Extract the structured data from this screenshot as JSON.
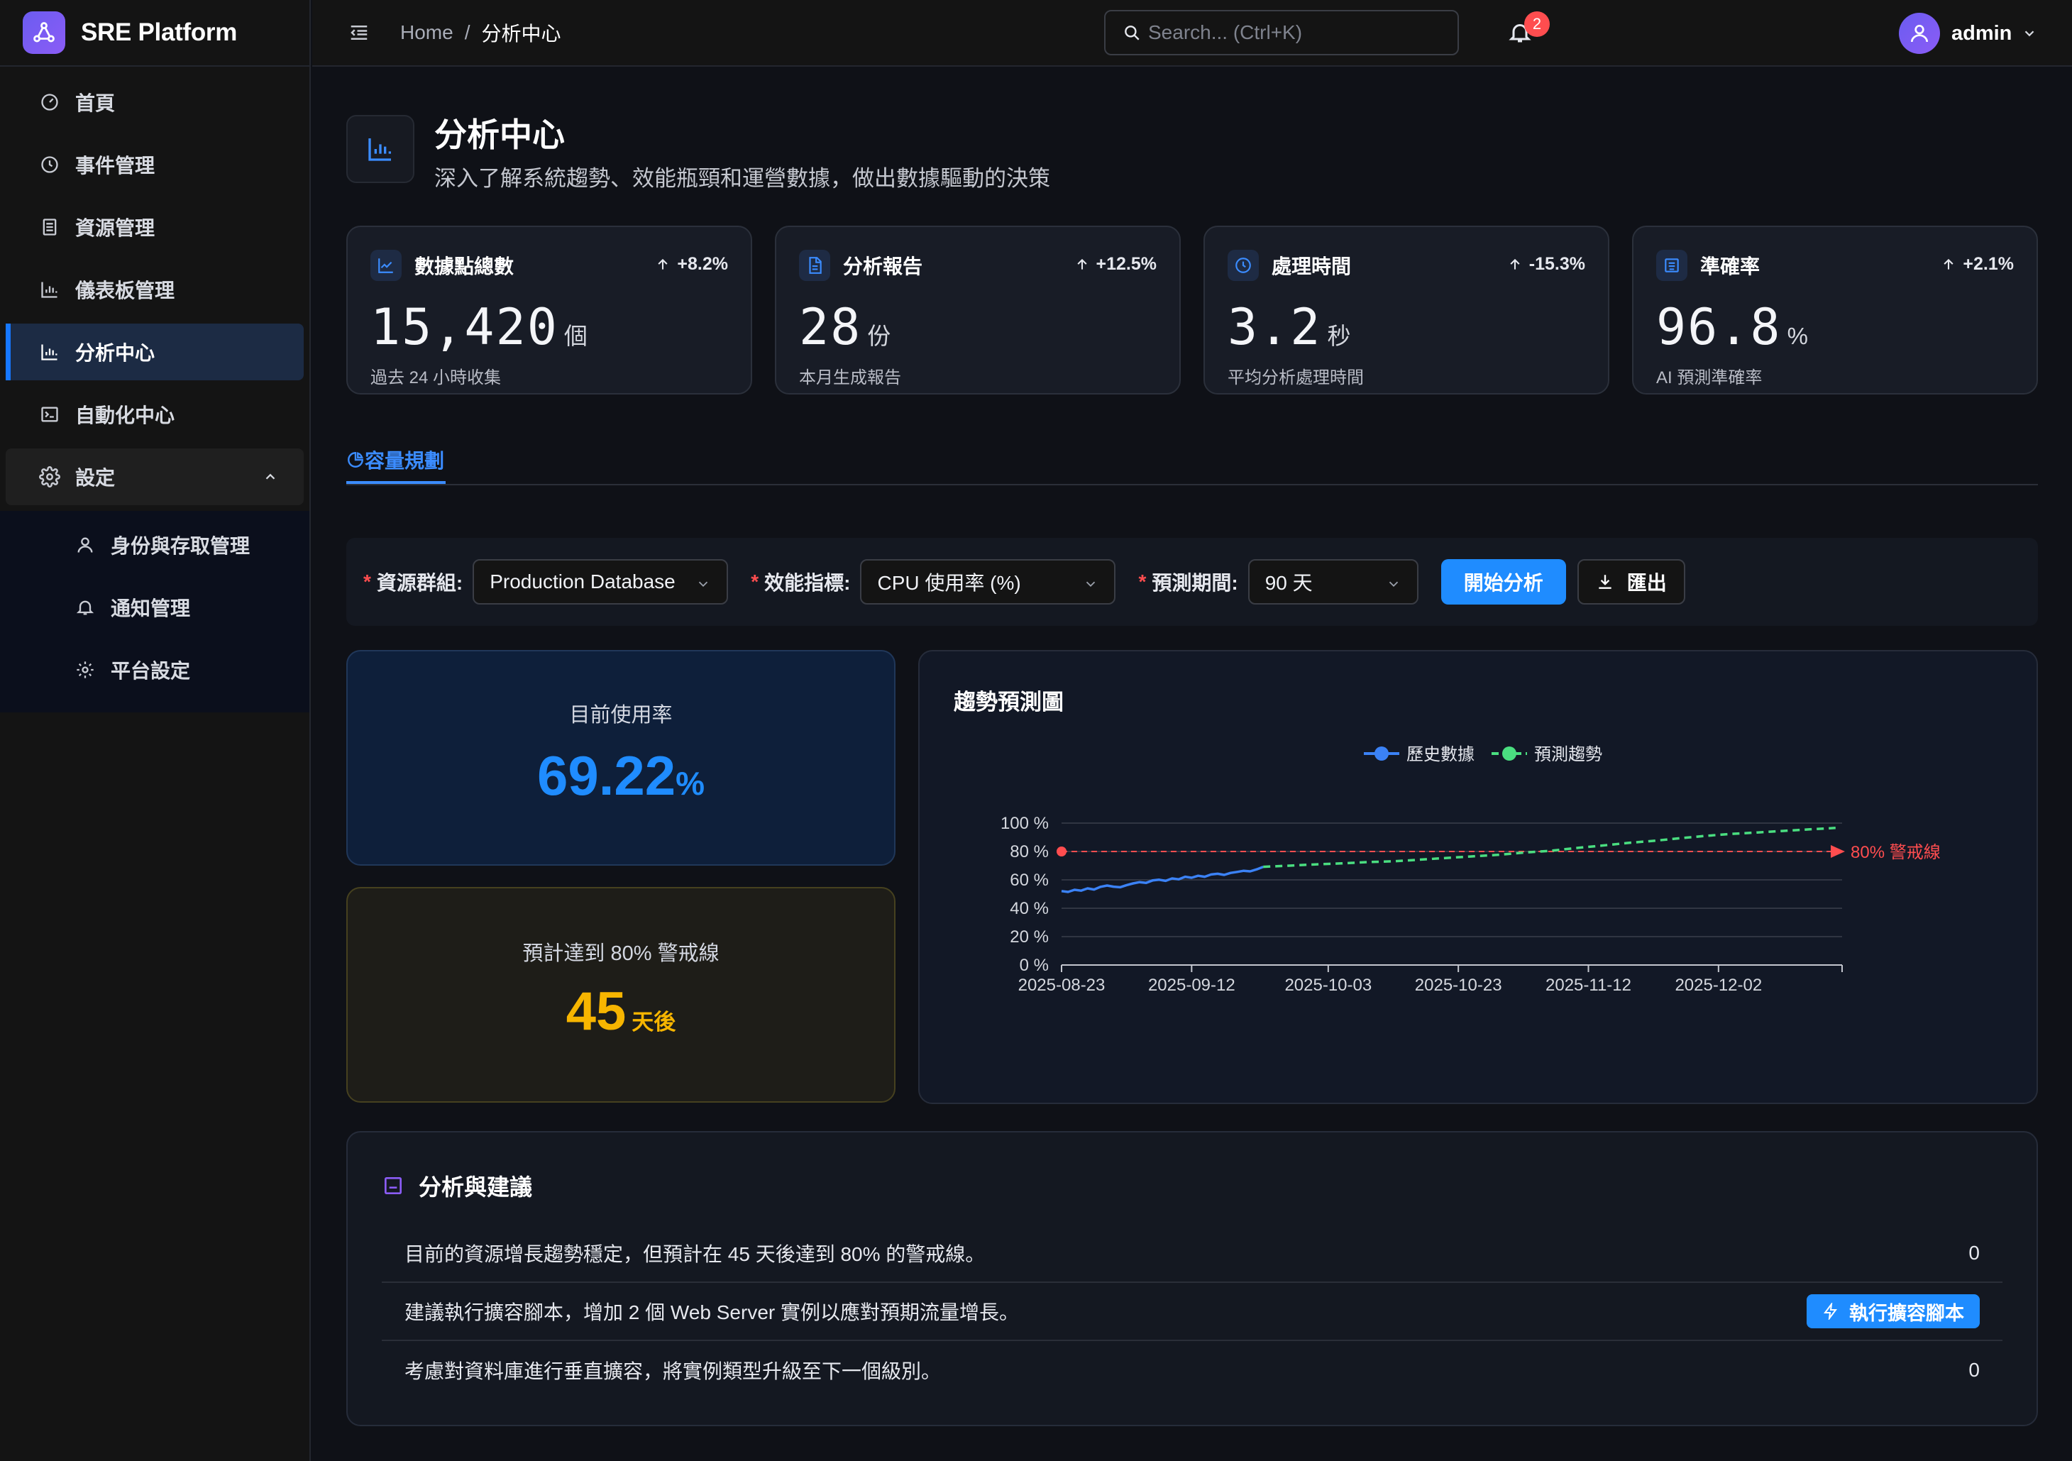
{
  "app": {
    "name": "SRE Platform"
  },
  "sidebar": {
    "items": [
      {
        "label": "首頁",
        "icon": "dashboard-gauge-icon"
      },
      {
        "label": "事件管理",
        "icon": "clock-icon"
      },
      {
        "label": "資源管理",
        "icon": "server-icon"
      },
      {
        "label": "儀表板管理",
        "icon": "bar-chart-icon"
      },
      {
        "label": "分析中心",
        "icon": "bar-chart-icon",
        "active": true
      },
      {
        "label": "自動化中心",
        "icon": "terminal-icon"
      },
      {
        "label": "設定",
        "icon": "gear-icon",
        "expanded": true
      }
    ],
    "submenu": [
      {
        "label": "身份與存取管理",
        "icon": "user-icon"
      },
      {
        "label": "通知管理",
        "icon": "bell-icon"
      },
      {
        "label": "平台設定",
        "icon": "gear-icon"
      }
    ]
  },
  "header": {
    "breadcrumb": {
      "home": "Home",
      "separator": "/",
      "current": "分析中心"
    },
    "search": {
      "placeholder": "Search... (Ctrl+K)"
    },
    "notifications": {
      "count": "2"
    },
    "user": {
      "name": "admin"
    }
  },
  "page": {
    "title": "分析中心",
    "subtitle": "深入了解系統趨勢、效能瓶頸和運營數據，做出數據驅動的決策"
  },
  "stats": [
    {
      "label": "數據點總數",
      "trend": "+8.2%",
      "value": "15,420",
      "unit": "個",
      "desc": "過去 24 小時收集",
      "icon": "line-chart-icon"
    },
    {
      "label": "分析報告",
      "trend": "+12.5%",
      "value": "28",
      "unit": "份",
      "desc": "本月生成報告",
      "icon": "file-text-icon"
    },
    {
      "label": "處理時間",
      "trend": "-15.3%",
      "value": "3.2",
      "unit": "秒",
      "desc": "平均分析處理時間",
      "icon": "clock-icon"
    },
    {
      "label": "準確率",
      "trend": "+2.1%",
      "value": "96.8",
      "unit": "%",
      "desc": "AI 預測準確率",
      "icon": "robot-icon"
    }
  ],
  "tabs": [
    {
      "label": "容量規劃",
      "icon": "pie-chart-icon",
      "active": true
    }
  ],
  "filters": {
    "resource_group": {
      "label": "資源群組:",
      "value": "Production Database"
    },
    "metric": {
      "label": "效能指標:",
      "value": "CPU 使用率 (%)"
    },
    "period": {
      "label": "預測期間:",
      "value": "90 天"
    },
    "required_mark": "*",
    "start_button": "開始分析",
    "export_button": "匯出"
  },
  "usage": {
    "label": "目前使用率",
    "value": "69.22",
    "unit": "%"
  },
  "eta": {
    "label": "預計達到 80% 警戒線",
    "value": "45",
    "unit": "天後"
  },
  "chart_title": "趨勢預測圖",
  "chart_data": {
    "type": "line",
    "title": "趨勢預測圖",
    "xlabel": "",
    "ylabel": "",
    "y_ticks": [
      "0 %",
      "20 %",
      "40 %",
      "60 %",
      "80 %",
      "100 %"
    ],
    "ylim": [
      0,
      100
    ],
    "x_ticks": [
      "2025-08-23",
      "2025-09-12",
      "2025-10-03",
      "2025-10-23",
      "2025-11-12",
      "2025-12-02"
    ],
    "legend_position": "top-center",
    "threshold": {
      "value": 80,
      "label": "80% 警戒線",
      "color": "#ff4d4f"
    },
    "series": [
      {
        "name": "歷史數據",
        "color": "#3b82f6",
        "style": "solid",
        "points": [
          [
            "2025-08-23",
            52.1
          ],
          [
            "2025-08-24",
            51.5
          ],
          [
            "2025-08-25",
            53.0
          ],
          [
            "2025-08-26",
            52.4
          ],
          [
            "2025-08-27",
            54.0
          ],
          [
            "2025-08-28",
            53.2
          ],
          [
            "2025-08-29",
            55.1
          ],
          [
            "2025-08-30",
            56.0
          ],
          [
            "2025-08-31",
            55.2
          ],
          [
            "2025-09-01",
            54.8
          ],
          [
            "2025-09-02",
            56.3
          ],
          [
            "2025-09-03",
            57.5
          ],
          [
            "2025-09-04",
            58.4
          ],
          [
            "2025-09-05",
            57.9
          ],
          [
            "2025-09-06",
            59.6
          ],
          [
            "2025-09-07",
            60.1
          ],
          [
            "2025-09-08",
            59.3
          ],
          [
            "2025-09-09",
            61.0
          ],
          [
            "2025-09-10",
            60.4
          ],
          [
            "2025-09-11",
            62.2
          ],
          [
            "2025-09-12",
            61.5
          ],
          [
            "2025-09-13",
            62.9
          ],
          [
            "2025-09-14",
            62.2
          ],
          [
            "2025-09-15",
            63.8
          ],
          [
            "2025-09-16",
            64.3
          ],
          [
            "2025-09-17",
            63.5
          ],
          [
            "2025-09-18",
            64.9
          ],
          [
            "2025-09-19",
            65.6
          ],
          [
            "2025-09-20",
            66.4
          ],
          [
            "2025-09-21",
            66.0
          ],
          [
            "2025-09-22",
            67.4
          ],
          [
            "2025-09-23",
            69.22
          ]
        ]
      },
      {
        "name": "預測趨勢",
        "color": "#4ade80",
        "style": "dashed",
        "points": [
          [
            "2025-09-23",
            69.22
          ],
          [
            "2025-09-27",
            70.0
          ],
          [
            "2025-10-01",
            70.9
          ],
          [
            "2025-10-05",
            71.6
          ],
          [
            "2025-10-09",
            72.5
          ],
          [
            "2025-10-13",
            73.1
          ],
          [
            "2025-10-17",
            74.2
          ],
          [
            "2025-10-21",
            75.4
          ],
          [
            "2025-10-25",
            76.5
          ],
          [
            "2025-10-29",
            77.6
          ],
          [
            "2025-11-02",
            79.2
          ],
          [
            "2025-11-06",
            80.4
          ],
          [
            "2025-11-10",
            82.4
          ],
          [
            "2025-11-14",
            84.1
          ],
          [
            "2025-11-18",
            86.0
          ],
          [
            "2025-11-22",
            87.5
          ],
          [
            "2025-11-26",
            89.3
          ],
          [
            "2025-11-30",
            91.0
          ],
          [
            "2025-12-04",
            92.4
          ],
          [
            "2025-12-08",
            93.4
          ],
          [
            "2025-12-12",
            94.5
          ],
          [
            "2025-12-16",
            95.6
          ],
          [
            "2025-12-20",
            96.6
          ]
        ]
      }
    ]
  },
  "advice": {
    "title": "分析與建議",
    "rows": [
      {
        "text": "目前的資源增長趨勢穩定，但預計在 45 天後達到 80% 的警戒線。",
        "count": "0"
      },
      {
        "text": "建議執行擴容腳本，增加 2 個 Web Server 實例以應對預期流量增長。",
        "action": "執行擴容腳本"
      },
      {
        "text": "考慮對資料庫進行垂直擴容，將實例類型升級至下一個級別。",
        "count": "0"
      }
    ]
  }
}
